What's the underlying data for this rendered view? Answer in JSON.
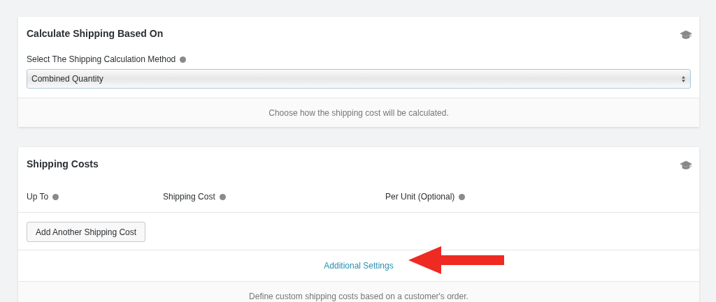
{
  "calculation_card": {
    "title": "Calculate Shipping Based On",
    "field_label": "Select The Shipping Calculation Method",
    "select": {
      "value": "Combined Quantity"
    },
    "footer": "Choose how the shipping cost will be calculated."
  },
  "costs_card": {
    "title": "Shipping Costs",
    "columns": [
      "Up To",
      "Shipping Cost",
      "Per Unit (Optional)"
    ],
    "add_button": "Add Another Shipping Cost",
    "link": "Additional Settings",
    "footer": "Define custom shipping costs based on a customer's order."
  }
}
